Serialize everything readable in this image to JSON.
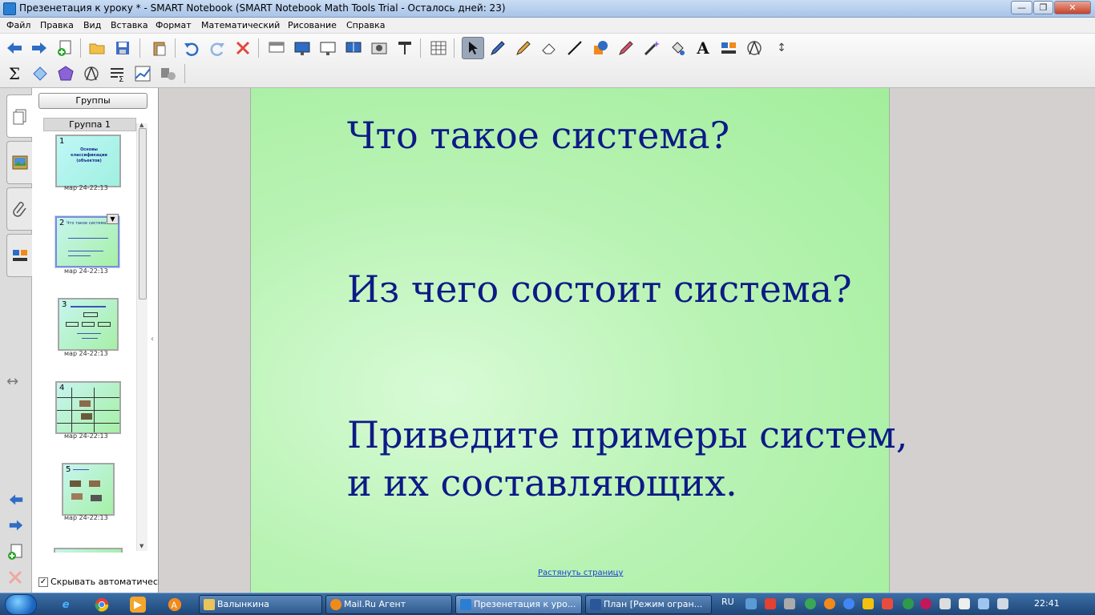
{
  "window": {
    "title": "Презенетация к уроку * - SMART Notebook (SMART Notebook Math Tools Trial - Осталось дней: 23)",
    "controls": {
      "minimize": "—",
      "maximize": "❐",
      "close": "✕"
    }
  },
  "menu": {
    "items": [
      "Файл",
      "Правка",
      "Вид",
      "Вставка",
      "Формат",
      "Математический",
      "Рисование",
      "Справка"
    ]
  },
  "toolbar": {
    "row1": [
      "back-arrow-icon",
      "forward-arrow-icon",
      "new-page-icon",
      "open-folder-icon",
      "save-icon",
      "paste-icon",
      "undo-icon",
      "redo-icon",
      "delete-icon",
      "screen-shade-icon",
      "projector-icon",
      "full-screen-icon",
      "dual-page-icon",
      "screen-capture-icon",
      "doc-camera-icon",
      "table-icon",
      "select-pointer-icon",
      "pen-icon",
      "creative-pen-icon",
      "eraser-icon",
      "line-icon",
      "shapes-icon",
      "highlighter-icon",
      "magic-pen-icon",
      "fill-icon",
      "text-icon",
      "properties-icon",
      "geometry-icon",
      "resize-toolbar-icon"
    ],
    "row2": [
      "sigma-icon",
      "shape-recognition-icon",
      "polygon-icon",
      "compass-icon",
      "equation-icon",
      "graph-icon",
      "math-tools-icon"
    ],
    "text_tool_glyph": "A"
  },
  "sidebar_tabs": {
    "tabs": [
      "page-sorter-tab",
      "gallery-tab",
      "attachments-tab",
      "properties-tab"
    ],
    "resize_glyph": "↔"
  },
  "sorter": {
    "groups_button": "Группы",
    "group_name": "Группа 1",
    "autohide_label": "Скрывать автоматическ",
    "autohide_checked": true,
    "pages": [
      {
        "number": "1",
        "date": "мар 24-22:13",
        "title": "Основы классификации (объектов)",
        "selected": false
      },
      {
        "number": "2",
        "date": "мар 24-22:13",
        "title": "Что такое система?",
        "selected": true
      },
      {
        "number": "3",
        "date": "мар 24-22:13",
        "title": "",
        "selected": false
      },
      {
        "number": "4",
        "date": "мар 24-22:13",
        "title": "",
        "selected": false
      },
      {
        "number": "5",
        "date": "мар 24-22:13",
        "title": "",
        "selected": false
      }
    ]
  },
  "slide": {
    "question1": "Что такое система?",
    "question2": "Из чего состоит система?",
    "question3_line1": "Приведите примеры систем,",
    "question3_line2": "и их составляющих.",
    "stretch_link": "Растянуть страницу",
    "text_color": "#0d1a86",
    "background": "#b9f3b4"
  },
  "taskbar": {
    "tasks": [
      {
        "label": "Валынкина",
        "active": false
      },
      {
        "label": "Mail.Ru Агент",
        "active": false
      },
      {
        "label": "Презенетация к уро...",
        "active": true
      },
      {
        "label": "План [Режим огран...",
        "active": false
      }
    ],
    "language": "RU",
    "clock": "22:41"
  }
}
